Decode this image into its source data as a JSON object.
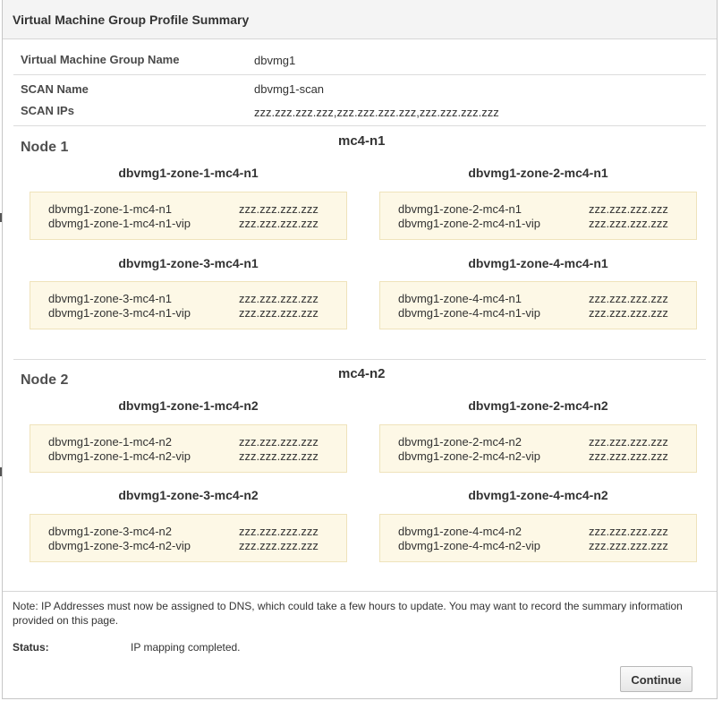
{
  "dialog": {
    "title": "Virtual Machine Group Profile Summary"
  },
  "summary": {
    "group_name_label": "Virtual Machine Group Name",
    "group_name_value": "dbvmg1",
    "scan_name_label": "SCAN Name",
    "scan_name_value": "dbvmg1-scan",
    "scan_ips_label": "SCAN IPs",
    "scan_ips_value": "zzz.zzz.zzz.zzz,zzz.zzz.zzz.zzz,zzz.zzz.zzz.zzz"
  },
  "nodes": [
    {
      "title": "Node 1",
      "host": "mc4-n1",
      "zones": [
        {
          "name": "dbvmg1-zone-1-mc4-n1",
          "rows": [
            {
              "host": "dbvmg1-zone-1-mc4-n1",
              "ip": "zzz.zzz.zzz.zzz"
            },
            {
              "host": "dbvmg1-zone-1-mc4-n1-vip",
              "ip": "zzz.zzz.zzz.zzz"
            }
          ]
        },
        {
          "name": "dbvmg1-zone-2-mc4-n1",
          "rows": [
            {
              "host": "dbvmg1-zone-2-mc4-n1",
              "ip": "zzz.zzz.zzz.zzz"
            },
            {
              "host": "dbvmg1-zone-2-mc4-n1-vip",
              "ip": "zzz.zzz.zzz.zzz"
            }
          ]
        },
        {
          "name": "dbvmg1-zone-3-mc4-n1",
          "rows": [
            {
              "host": "dbvmg1-zone-3-mc4-n1",
              "ip": "zzz.zzz.zzz.zzz"
            },
            {
              "host": "dbvmg1-zone-3-mc4-n1-vip",
              "ip": "zzz.zzz.zzz.zzz"
            }
          ]
        },
        {
          "name": "dbvmg1-zone-4-mc4-n1",
          "rows": [
            {
              "host": "dbvmg1-zone-4-mc4-n1",
              "ip": "zzz.zzz.zzz.zzz"
            },
            {
              "host": "dbvmg1-zone-4-mc4-n1-vip",
              "ip": "zzz.zzz.zzz.zzz"
            }
          ]
        }
      ]
    },
    {
      "title": "Node 2",
      "host": "mc4-n2",
      "zones": [
        {
          "name": "dbvmg1-zone-1-mc4-n2",
          "rows": [
            {
              "host": "dbvmg1-zone-1-mc4-n2",
              "ip": "zzz.zzz.zzz.zzz"
            },
            {
              "host": "dbvmg1-zone-1-mc4-n2-vip",
              "ip": "zzz.zzz.zzz.zzz"
            }
          ]
        },
        {
          "name": "dbvmg1-zone-2-mc4-n2",
          "rows": [
            {
              "host": "dbvmg1-zone-2-mc4-n2",
              "ip": "zzz.zzz.zzz.zzz"
            },
            {
              "host": "dbvmg1-zone-2-mc4-n2-vip",
              "ip": "zzz.zzz.zzz.zzz"
            }
          ]
        },
        {
          "name": "dbvmg1-zone-3-mc4-n2",
          "rows": [
            {
              "host": "dbvmg1-zone-3-mc4-n2",
              "ip": "zzz.zzz.zzz.zzz"
            },
            {
              "host": "dbvmg1-zone-3-mc4-n2-vip",
              "ip": "zzz.zzz.zzz.zzz"
            }
          ]
        },
        {
          "name": "dbvmg1-zone-4-mc4-n2",
          "rows": [
            {
              "host": "dbvmg1-zone-4-mc4-n2",
              "ip": "zzz.zzz.zzz.zzz"
            },
            {
              "host": "dbvmg1-zone-4-mc4-n2-vip",
              "ip": "zzz.zzz.zzz.zzz"
            }
          ]
        }
      ]
    }
  ],
  "footer": {
    "note": "Note: IP Addresses must now be assigned to DNS, which could take a few hours to update. You may want to record the summary information provided on this page.",
    "status_label": "Status:",
    "status_value": "IP mapping completed.",
    "continue_label": "Continue"
  }
}
